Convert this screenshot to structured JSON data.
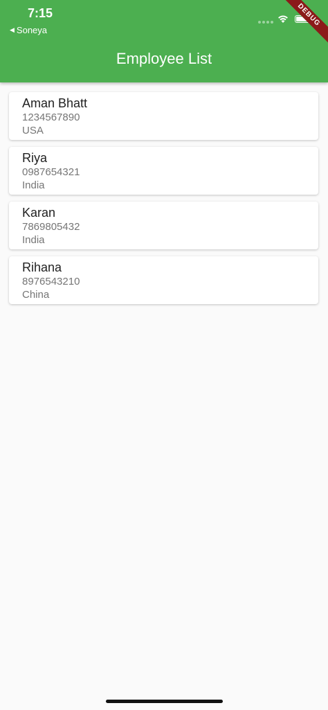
{
  "status_bar": {
    "time": "7:15",
    "back_app": "Soneya",
    "back_arrow": "◀"
  },
  "debug_banner": "DEBUG",
  "app_bar": {
    "title": "Employee List",
    "color": "#4caf50"
  },
  "employees": [
    {
      "name": "Aman Bhatt",
      "phone": "1234567890",
      "country": "USA"
    },
    {
      "name": "Riya",
      "phone": "0987654321",
      "country": "India"
    },
    {
      "name": "Karan",
      "phone": "7869805432",
      "country": "India"
    },
    {
      "name": "Rihana",
      "phone": "8976543210",
      "country": "China"
    }
  ]
}
